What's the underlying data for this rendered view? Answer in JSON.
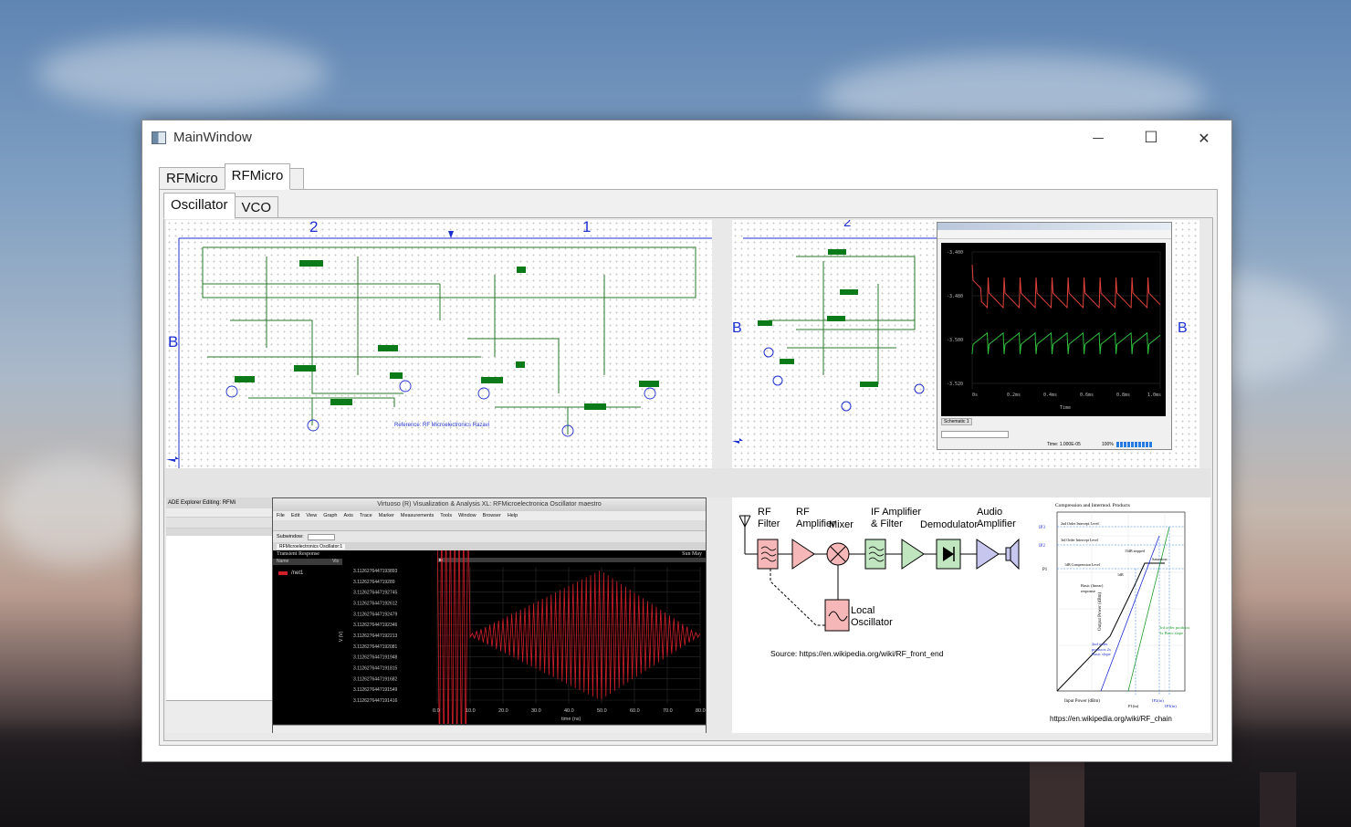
{
  "window": {
    "title": "MainWindow",
    "minimize_glyph": "—",
    "maximize_glyph": "☐",
    "close_glyph": "✕"
  },
  "outer_tabs": [
    {
      "label": "RFMicro",
      "active": false
    },
    {
      "label": "RFMicro",
      "active": true
    }
  ],
  "inner_tabs": [
    {
      "label": "Oscillator",
      "active": true
    },
    {
      "label": "VCO",
      "active": false
    }
  ],
  "schematic_left": {
    "col_markers": [
      "2",
      "1"
    ],
    "row_marker": "B",
    "reference_text": "Reference: RF Microelectronics Razavi"
  },
  "schematic_right": {
    "col_marker": "2",
    "row_marker_left": "B",
    "row_marker_right": "B"
  },
  "scope_window": {
    "tab_label": "Schematic 1",
    "status_time": "Time: 1.000E-05",
    "status_zoom": "100%",
    "y_ticks": [
      "-3.400",
      "-3.480",
      "-3.500",
      "-3.520"
    ],
    "x_label": "Time",
    "x_ticks": [
      "0s",
      "0.2ms",
      "0.4ms",
      "0.6ms",
      "0.8ms",
      "1.0ms"
    ]
  },
  "virtuoso": {
    "title": "Virtuoso (R) Visualization & Analysis XL: RFMicroelectronica Oscillator maestro",
    "side_title": "ADE Explorer Editing: RFMi",
    "menu": [
      "File",
      "Edit",
      "View",
      "Graph",
      "Axis",
      "Trace",
      "Marker",
      "Measurements",
      "Tools",
      "Window",
      "Browser",
      "Help"
    ],
    "subwindow_label": "Subwindow:",
    "file_tab": "RFMicroelectronics Oscillator:1",
    "plot_title": "Transient Response",
    "date_label": "Sun May",
    "legend_header": [
      "Name",
      "Vis"
    ],
    "trace_name": "/net1",
    "x_axis_label": "time (ns)",
    "x_ticks": [
      "0.0",
      "10.0",
      "20.0",
      "30.0",
      "40.0",
      "50.0",
      "60.0",
      "70.0",
      "80.0"
    ],
    "y_ticks": [
      "3.1126276447193893",
      "3.112627644719289",
      "3.1126276447192745",
      "3.1126276447192612",
      "3.1126276447192479",
      "3.1126276447192346",
      "3.1126276447192213",
      "3.1126276447192081",
      "3.1126276447191948",
      "3.1126276447191815",
      "3.1126276447191682",
      "3.1126276447191549",
      "3.1126276447191416"
    ],
    "y_axis_label": "V (V)",
    "trace_color": "#d01f2a"
  },
  "rf_chain": {
    "blocks": [
      "RF Filter",
      "RF Amplifier",
      "Mixer",
      "IF Amplifier & Filter",
      "Demodulator",
      "Audio Amplifier",
      "Local Oscillator"
    ],
    "labels": {
      "rf_filter": "RF\nFilter",
      "rf_amp": "RF\nAmplifier",
      "mixer": "Mixer",
      "if_amp": "IF Amplifier\n& Filter",
      "demod": "Demodulator",
      "audio": "Audio\nAmplifier",
      "lo": "Local\nOscillator"
    },
    "source": "Source:  https://en.wikipedia.org/wiki/RF_front_end"
  },
  "compression_plot": {
    "title": "Compression and Intermod. Products",
    "y_axis": "Output Power (dBm)",
    "x_axis": "Input Power (dBm)",
    "labels": [
      "2nd Order Intercept Level",
      "3rd Order Intercept Level",
      "1dB Compression Level",
      "Saturation",
      "Basic (linear) response",
      "2nd order products 2x Basic slope",
      "3rd order products 3x Basic slope",
      "1dB",
      "15dB stepped"
    ],
    "left_ticks": [
      "IP3",
      "IP2",
      "P1"
    ],
    "bottom_ticks": [
      "P1(in)",
      "IP2(in)",
      "IP3(in)"
    ],
    "source": "https://en.wikipedia.org/wiki/RF_chain"
  }
}
